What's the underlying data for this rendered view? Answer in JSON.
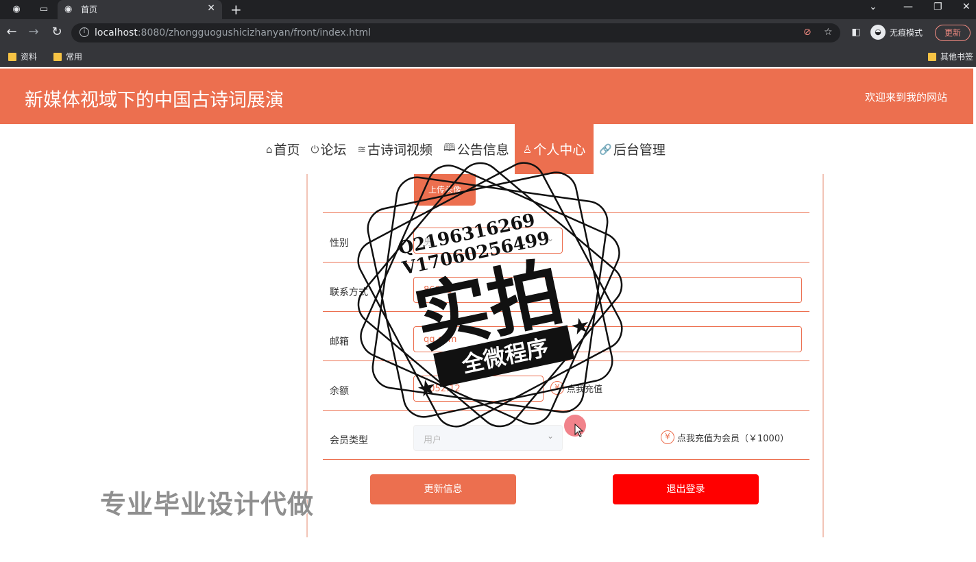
{
  "browser": {
    "tab_title": "首页",
    "url_host": "localhost",
    "url_rest": ":8080/zhongguogushicizhanyan/front/index.html",
    "profile_label": "无痕模式",
    "update_label": "更新",
    "bookmarks": [
      "资料",
      "常用"
    ],
    "other_bookmarks": "其他书签"
  },
  "site": {
    "title": "新媒体视域下的中国古诗词展演",
    "welcome": "欢迎来到我的网站"
  },
  "menu": [
    {
      "icon": "⌂",
      "label": "首页"
    },
    {
      "icon": "⏻",
      "label": "论坛"
    },
    {
      "icon": "≋",
      "label": "古诗词视频"
    },
    {
      "icon": "🕮",
      "label": "公告信息"
    },
    {
      "icon": "♙",
      "label": "个人中心"
    },
    {
      "icon": "🔗",
      "label": "后台管理"
    }
  ],
  "form": {
    "upload_label": "上传头像",
    "gender_label": "性别",
    "gender_value": "男",
    "phone_label": "联系方式",
    "phone_value": "86901",
    "email_label": "邮箱",
    "email_value": "qq.com",
    "balance_label": "余额",
    "balance_value": "1052.12",
    "recharge_label": "点我充值",
    "member_label": "会员类型",
    "member_value": "用户",
    "member_recharge_label": "点我充值为会员（￥1000）",
    "update_button": "更新信息",
    "logout_button": "退出登录"
  },
  "watermark": {
    "bottom_text": "专业毕业设计代做",
    "stamp_line1": "Q2196316269",
    "stamp_line2": "V17060256499",
    "stamp_big": "实拍",
    "stamp_banner": "全微程序"
  }
}
